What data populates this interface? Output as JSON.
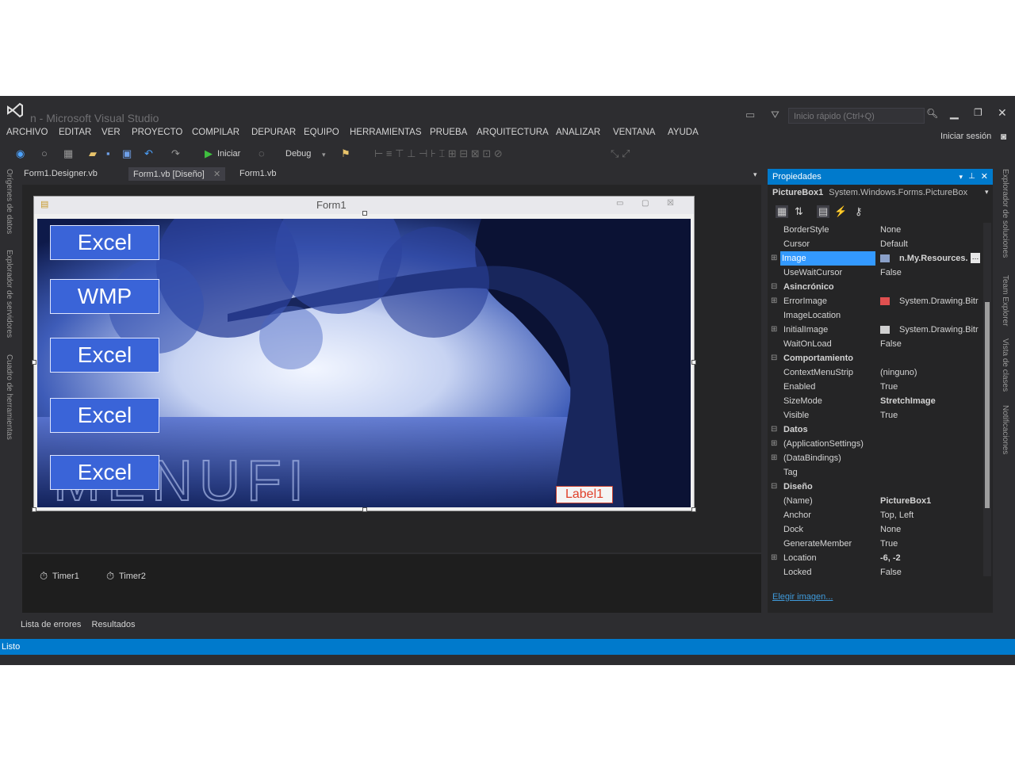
{
  "window": {
    "title": "n - Microsoft Visual Studio",
    "quick_launch_placeholder": "Inicio rápido (Ctrl+Q)",
    "sign_in": "Iniciar sesión"
  },
  "menu": [
    "ARCHIVO",
    "EDITAR",
    "VER",
    "PROYECTO",
    "COMPILAR",
    "DEPURAR",
    "EQUIPO",
    "HERRAMIENTAS",
    "PRUEBA",
    "ARQUITECTURA",
    "ANALIZAR",
    "VENTANA",
    "AYUDA"
  ],
  "toolbar": {
    "start_label": "Iniciar",
    "config_label": "Debug"
  },
  "doc_tabs": [
    "Form1.Designer.vb",
    "Form1.vb [Diseño]",
    "Form1.vb"
  ],
  "left_sidebar": [
    "Orígenes de datos",
    "Explorador de servidores",
    "Cuadro de herramientas"
  ],
  "right_sidebar": [
    "Explorador de soluciones",
    "Team Explorer",
    "Vista de clases",
    "Notificaciones"
  ],
  "form": {
    "title": "Form1",
    "buttons": [
      "Excel",
      "WMP",
      "Excel",
      "Excel",
      "Excel"
    ],
    "label": "Label1",
    "watermark": "MENUFI"
  },
  "tray": {
    "items": [
      "Timer1",
      "Timer2"
    ]
  },
  "bottom_tabs": [
    "Lista de errores",
    "Resultados"
  ],
  "status": "Listo",
  "properties": {
    "header": "Propiedades",
    "object_name": "PictureBox1",
    "object_type": "System.Windows.Forms.PictureBox",
    "rows": [
      {
        "name": "BorderStyle",
        "value": "None"
      },
      {
        "name": "Cursor",
        "value": "Default"
      },
      {
        "name": "Image",
        "value": "n.My.Resources.",
        "selected": true,
        "exp": "⊞"
      },
      {
        "name": "UseWaitCursor",
        "value": "False"
      },
      {
        "name": "Asincrónico",
        "category": true
      },
      {
        "name": "ErrorImage",
        "value": "System.Drawing.Bitr",
        "exp": "⊞",
        "icon": "error"
      },
      {
        "name": "ImageLocation",
        "value": ""
      },
      {
        "name": "InitialImage",
        "value": "System.Drawing.Bitr",
        "exp": "⊞",
        "icon": "image"
      },
      {
        "name": "WaitOnLoad",
        "value": "False"
      },
      {
        "name": "Comportamiento",
        "category": true
      },
      {
        "name": "ContextMenuStrip",
        "value": "(ninguno)"
      },
      {
        "name": "Enabled",
        "value": "True"
      },
      {
        "name": "SizeMode",
        "value": "StretchImage",
        "bold": true
      },
      {
        "name": "Visible",
        "value": "True"
      },
      {
        "name": "Datos",
        "category": true
      },
      {
        "name": "(ApplicationSettings)",
        "value": "",
        "exp": "⊞"
      },
      {
        "name": "(DataBindings)",
        "value": "",
        "exp": "⊞"
      },
      {
        "name": "Tag",
        "value": ""
      },
      {
        "name": "Diseño",
        "category": true
      },
      {
        "name": "(Name)",
        "value": "PictureBox1",
        "bold": true
      },
      {
        "name": "Anchor",
        "value": "Top, Left"
      },
      {
        "name": "Dock",
        "value": "None"
      },
      {
        "name": "GenerateMember",
        "value": "True"
      },
      {
        "name": "Location",
        "value": "-6, -2",
        "bold": true,
        "exp": "⊞"
      },
      {
        "name": "Locked",
        "value": "False"
      }
    ],
    "link": "Elegir imagen..."
  }
}
